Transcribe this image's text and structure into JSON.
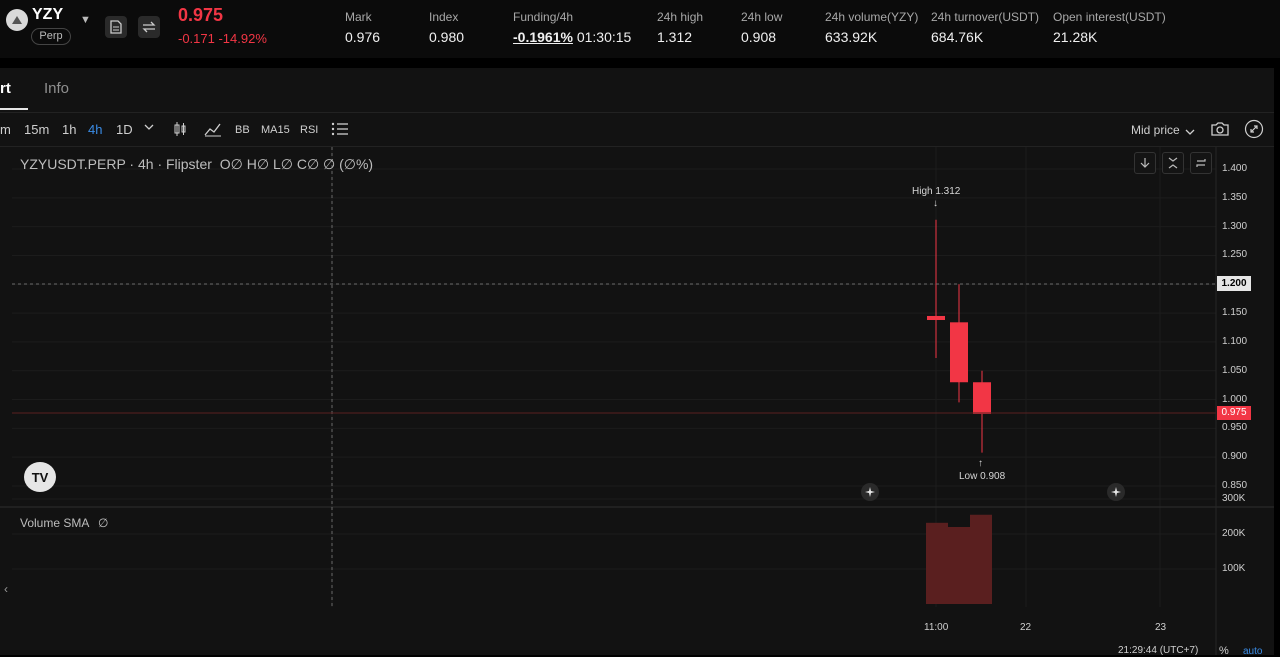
{
  "header": {
    "symbol": "YZY",
    "type_badge": "Perp",
    "last_price": "0.975",
    "change": "-0.171 -14.92%",
    "stats": [
      {
        "label": "Mark",
        "value": "0.976"
      },
      {
        "label": "Index",
        "value": "0.980"
      },
      {
        "label": "Funding/4h",
        "rate": "-0.1961%",
        "countdown": "01:30:15"
      },
      {
        "label": "24h high",
        "value": "1.312"
      },
      {
        "label": "24h low",
        "value": "0.908"
      },
      {
        "label": "24h volume(YZY)",
        "value": "633.92K"
      },
      {
        "label": "24h turnover(USDT)",
        "value": "684.76K"
      },
      {
        "label": "Open interest(USDT)",
        "value": "21.28K"
      }
    ]
  },
  "tabs": [
    {
      "label": "rt",
      "active": true
    },
    {
      "label": "Info",
      "active": false
    }
  ],
  "toolbar": {
    "intervals": [
      "m",
      "15m",
      "1h",
      "4h",
      "1D"
    ],
    "active_interval": "4h",
    "indicators": [
      "BB",
      "MA15",
      "RSI"
    ],
    "price_source": "Mid price"
  },
  "chart": {
    "legend_symbol": "YZYUSDT.PERP · 4h · Flipster",
    "legend_ohlc": "O∅ H∅ L∅ C∅ ∅ (∅%)",
    "volume_legend": "Volume SMA",
    "volume_legend_icon": "∅",
    "high_label": "High 1.312",
    "low_label": "Low 0.908",
    "crosshair_price": "1.200",
    "last_price_tag": "0.975",
    "footer_time": "21:29:44 (UTC+7)",
    "footer_pct": "%",
    "footer_auto": "auto",
    "collapse_arrow": "‹",
    "tv_logo": "TV",
    "colors": {
      "down": "#f23645",
      "volume_down": "#5a1f1f",
      "up": "#089981"
    }
  },
  "chart_data": {
    "type": "candlestick",
    "y_ticks": [
      "1.400",
      "1.350",
      "1.300",
      "1.250",
      "1.200",
      "1.150",
      "1.100",
      "1.050",
      "1.000",
      "0.950",
      "0.900",
      "0.850"
    ],
    "ylim": [
      0.83,
      1.42
    ],
    "x_ticks": [
      "11:00",
      "22",
      "23"
    ],
    "candles": [
      {
        "o": 1.145,
        "h": 1.312,
        "l": 1.072,
        "c": 1.138
      },
      {
        "o": 1.134,
        "h": 1.2,
        "l": 0.995,
        "c": 1.03
      },
      {
        "o": 1.03,
        "h": 1.05,
        "l": 0.908,
        "c": 0.975
      }
    ],
    "volume_ticks": [
      "300K",
      "200K",
      "100K"
    ],
    "volume_max": 300000,
    "volumes": [
      232000,
      220000,
      255000
    ]
  }
}
